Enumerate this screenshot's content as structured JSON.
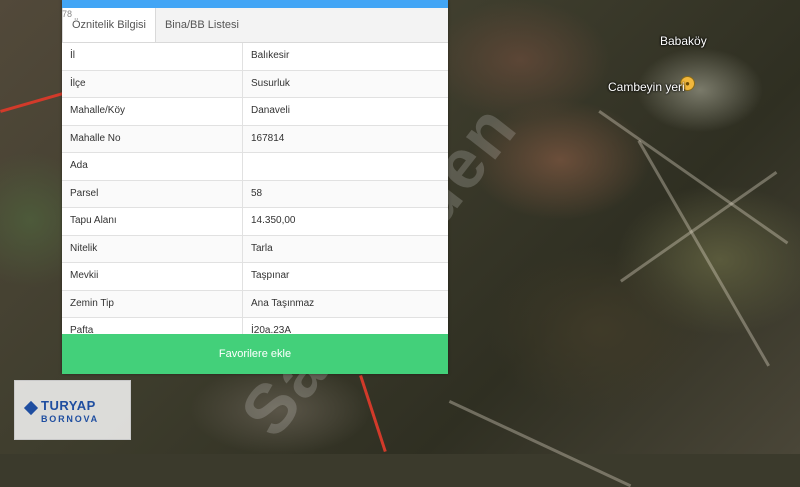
{
  "tabs": [
    {
      "label": "Öznitelik Bilgisi",
      "active": true
    },
    {
      "label": "Bina/BB Listesi",
      "active": false
    }
  ],
  "corner_number": "78",
  "attributes": [
    {
      "key": "İl",
      "value": "Balıkesir"
    },
    {
      "key": "İlçe",
      "value": "Susurluk"
    },
    {
      "key": "Mahalle/Köy",
      "value": "Danaveli"
    },
    {
      "key": "Mahalle No",
      "value": "167814"
    },
    {
      "key": "Ada",
      "value": ""
    },
    {
      "key": "Parsel",
      "value": "58"
    },
    {
      "key": "Tapu Alanı",
      "value": "14.350,00"
    },
    {
      "key": "Nitelik",
      "value": "Tarla"
    },
    {
      "key": "Mevkii",
      "value": "Taşpınar"
    },
    {
      "key": "Zemin Tip",
      "value": "Ana Taşınmaz"
    },
    {
      "key": "Pafta",
      "value": "İ20a.23A"
    }
  ],
  "favorite_button": "Favorilere ekle",
  "map_labels": {
    "village": "Babaköy",
    "place": "Cambeyin yeri"
  },
  "logo": {
    "line1": "TURYAP",
    "line2": "BORNOVA"
  },
  "colors": {
    "accent_bar": "#42a5f5",
    "button": "#43d07a",
    "logo": "#1f4ea0"
  }
}
